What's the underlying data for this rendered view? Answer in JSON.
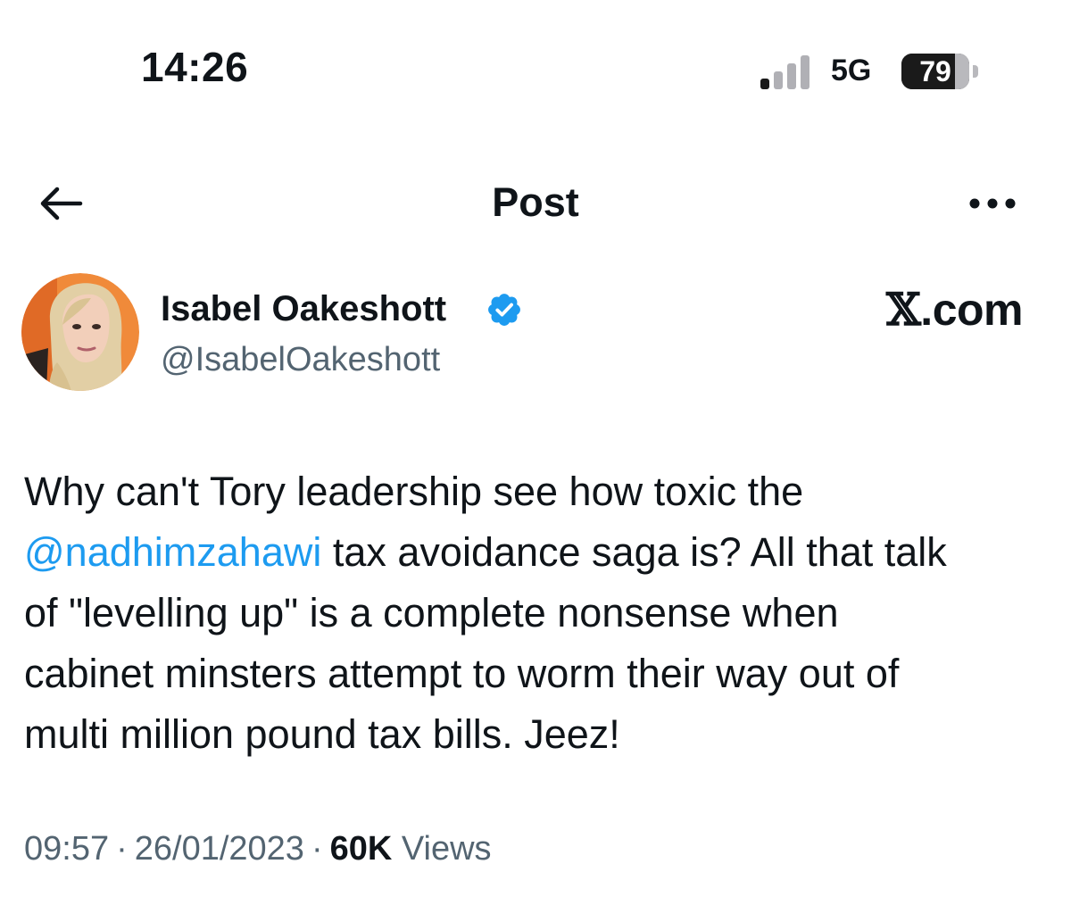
{
  "status_bar": {
    "time": "14:26",
    "network": "5G",
    "battery_percent": "79",
    "battery_level": 0.79,
    "signal_icon": "cellular-signal-icon",
    "signal_active_bars": 1,
    "signal_total_bars": 4
  },
  "header": {
    "title": "Post",
    "back_icon": "back-arrow-icon",
    "more_icon": "more-options-icon"
  },
  "author": {
    "display_name": "Isabel Oakeshott",
    "handle": "@IsabelOakeshott",
    "verified": true,
    "avatar_icon": "profile-photo"
  },
  "watermark": {
    "x": "𝕏",
    "suffix": ".com"
  },
  "post": {
    "lines": [
      {
        "text_before": "Why can't Tory leadership see how toxic the",
        "mention": "",
        "text_after": ""
      },
      {
        "text_before": "",
        "mention": "@nadhimzahawi",
        "text_after": " tax avoidance saga is? All that talk"
      },
      {
        "text_before": "of \"levelling up\" is a complete nonsense when",
        "mention": "",
        "text_after": ""
      },
      {
        "text_before": "cabinet minsters attempt to worm their way out of",
        "mention": "",
        "text_after": ""
      },
      {
        "text_before": "multi million pound tax bills. Jeez!",
        "mention": "",
        "text_after": ""
      }
    ]
  },
  "meta": {
    "time": "09:57",
    "separator": "·",
    "date": "26/01/2023",
    "views_count": "60K",
    "views_label": "Views"
  },
  "colors": {
    "text_primary": "#0f1419",
    "text_secondary": "#536471",
    "link": "#1d9bf0",
    "verified": "#1d9bf0",
    "avatar_background": "#f08a3a"
  }
}
